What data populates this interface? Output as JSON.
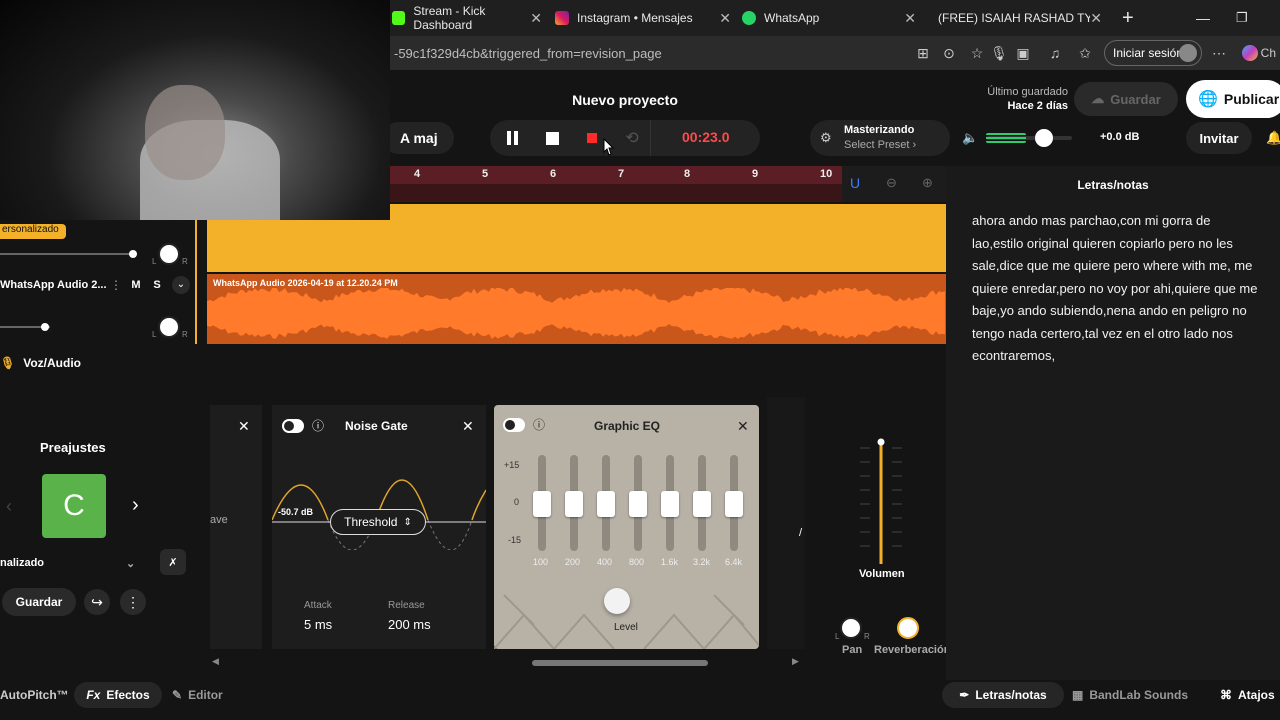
{
  "browser": {
    "tabs": [
      {
        "label": "Stream - Kick Dashboard"
      },
      {
        "label": "Instagram • Mensajes"
      },
      {
        "label": "WhatsApp"
      },
      {
        "label": "(FREE) ISAIAH RASHAD TYPE"
      }
    ],
    "url": "-59c1f329d4cb&triggered_from=revision_page",
    "signin_label": "Iniciar sesión",
    "copilot_label": "Ch"
  },
  "header": {
    "project_title": "Nuevo proyecto",
    "key_label": "A maj",
    "time": "00:23.0",
    "master_title": "Masterizando",
    "master_preset": "Select Preset",
    "volume_db": "+0.0 dB",
    "volume_level": 0.55,
    "last_saved_label": "Último guardado",
    "last_saved_value": "Hace 2 días",
    "save_label": "Guardar",
    "publish_label": "Publicar",
    "invite_label": "Invitar"
  },
  "timeline": {
    "bars": [
      "4",
      "5",
      "6",
      "7",
      "8",
      "9",
      "10"
    ]
  },
  "tracks": {
    "track1_badge": "ersonalizado",
    "track2_name": "WhatsApp Audio 2...",
    "mute": "M",
    "solo": "S",
    "clip_label": "WhatsApp Audio 2026-04-19 at 12.20.24 PM",
    "knob_l": "L",
    "knob_r": "R"
  },
  "instrument": {
    "label": "Voz/Audio"
  },
  "effects": {
    "presets_title": "Preajustes",
    "preset_letter": "C",
    "preset_name": "nalizado",
    "save_label": "Guardar",
    "card1_partial": "ave",
    "noise_gate": {
      "title": "Noise Gate",
      "db": "-50.7 dB",
      "threshold_label": "Threshold",
      "attack_label": "Attack",
      "attack_value": "5 ms",
      "release_label": "Release",
      "release_value": "200 ms"
    },
    "graphic_eq": {
      "title": "Graphic EQ",
      "scale": [
        "+15",
        "0",
        "-15"
      ],
      "bands": [
        "100",
        "200",
        "400",
        "800",
        "1.6k",
        "3.2k",
        "6.4k"
      ],
      "level_label": "Level"
    },
    "volume_label": "Volumen",
    "pan_label": "Pan",
    "reverb_label": "Reverberación"
  },
  "lyrics": {
    "title": "Letras/notas",
    "text": "ahora ando mas parchao,con mi gorra de lao,estilo original quieren copiarlo pero no les sale,dice que me quiere pero where with me, me quiere enredar,pero no voy por ahi,quiere que me baje,yo ando subiendo,nena ando en peligro no tengo nada certero,tal vez en el otro lado nos econtraremos,"
  },
  "bottombar": {
    "autopitch": "AutoPitch™",
    "effects": "Efectos",
    "editor": "Editor",
    "lyrics": "Letras/notas",
    "sounds": "BandLab Sounds",
    "shortcuts": "Atajos"
  },
  "colors": {
    "accent_yellow": "#f3b12a",
    "audio_orange": "#c9561b",
    "record_red": "#ff4a4a",
    "volume_green": "#2ecc71"
  }
}
